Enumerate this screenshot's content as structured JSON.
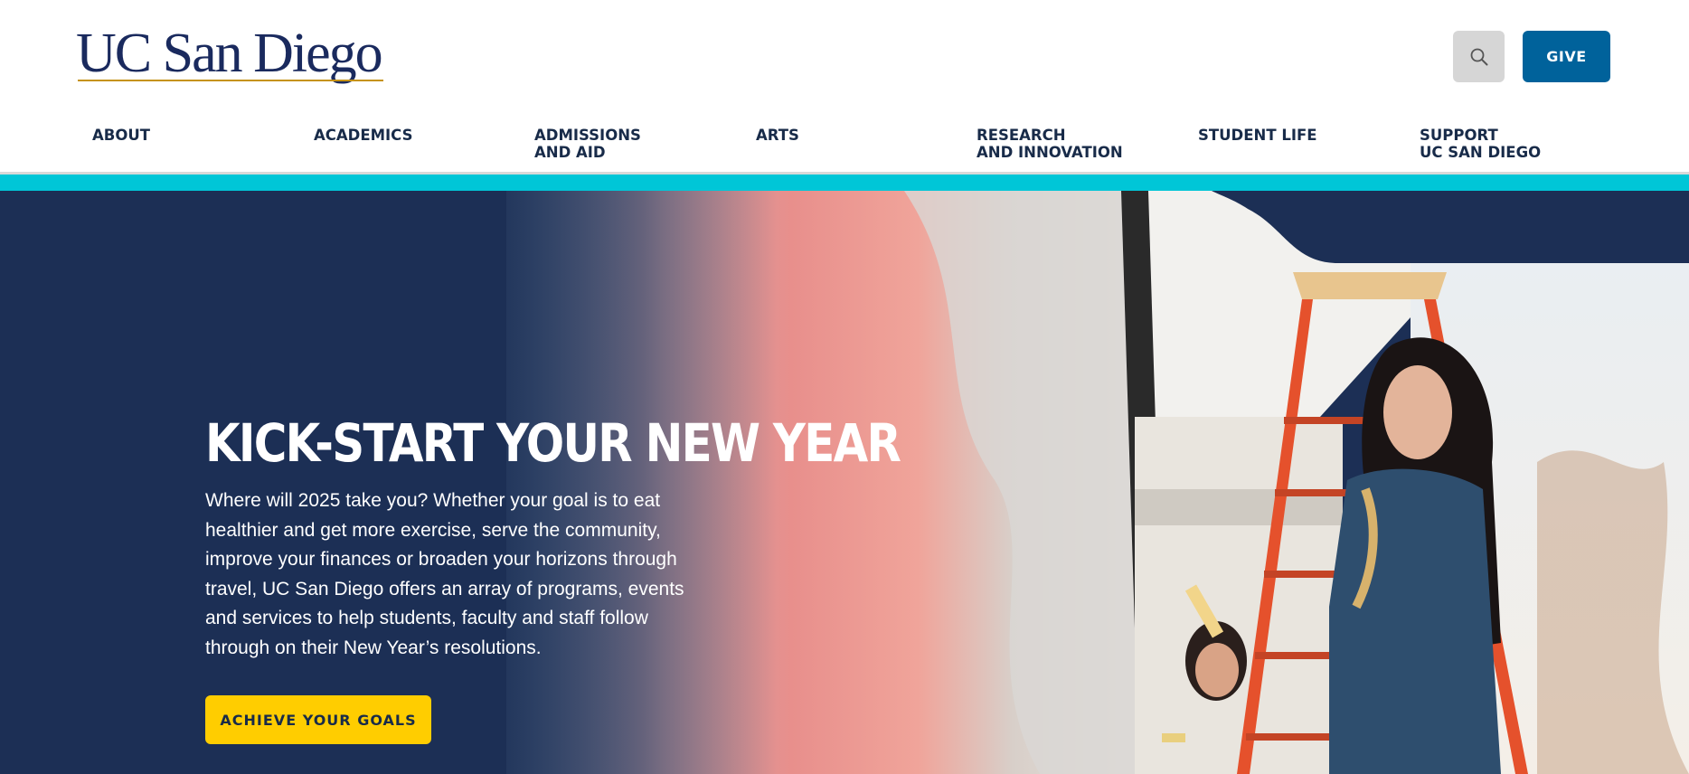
{
  "header": {
    "logo_text": "UC San Diego",
    "search_icon": "search-icon",
    "give_label": "GIVE"
  },
  "nav": {
    "items": [
      {
        "label": "ABOUT"
      },
      {
        "label": "ACADEMICS"
      },
      {
        "label": "ADMISSIONS\nAND AID"
      },
      {
        "label": "ARTS"
      },
      {
        "label": "RESEARCH\nAND INNOVATION"
      },
      {
        "label": "STUDENT LIFE"
      },
      {
        "label": "SUPPORT\nUC SAN DIEGO"
      }
    ]
  },
  "hero": {
    "title": "KICK-START YOUR NEW YEAR",
    "body": "Where will 2025 take you? Whether your goal is to eat healthier and get more exercise, serve the community, improve your finances or broaden your horizons through travel, UC San Diego offers an array of programs, events and services to help students, faculty and staff follow through on their New Year’s resolutions.",
    "cta_label": "ACHIEVE YOUR GOALS"
  },
  "colors": {
    "navy": "#182b49",
    "logo_navy": "#1a2a5e",
    "gold": "#c69214",
    "give_blue": "#00629b",
    "cyan": "#00c6d7",
    "yellow": "#ffcd00",
    "hero_navy": "#1c2f55"
  }
}
